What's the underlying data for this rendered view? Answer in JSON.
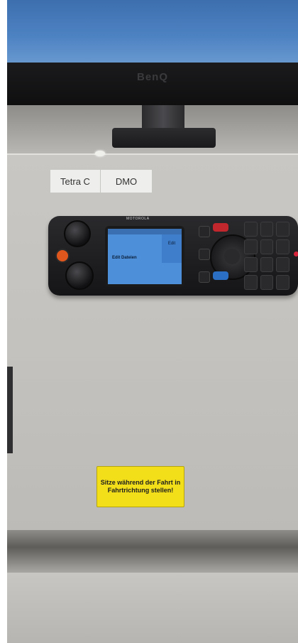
{
  "monitor": {
    "brand": "BenQ"
  },
  "tags": {
    "left": "Tetra C",
    "right": "DMO"
  },
  "radio": {
    "brand": "MOTOROLA",
    "screen_side": "Edit",
    "screen_text": "Edit Dateien"
  },
  "warning": {
    "text": "Sitze während der Fahrt in Fahrtrichtung stellen!"
  }
}
